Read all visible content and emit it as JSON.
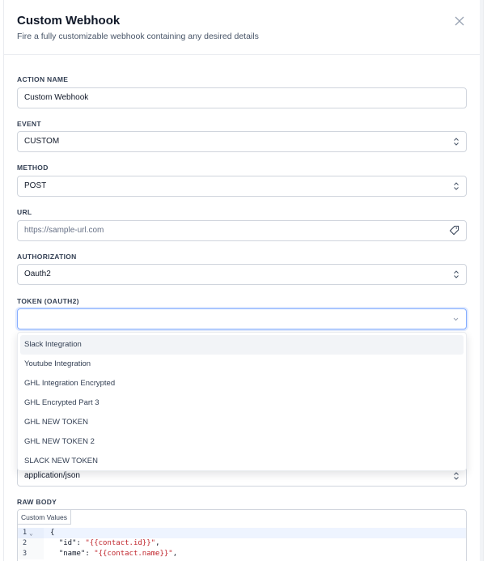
{
  "header": {
    "title": "Custom Webhook",
    "subtitle": "Fire a fully customizable webhook containing any desired details"
  },
  "form": {
    "action_name": {
      "label": "ACTION NAME",
      "value": "Custom Webhook"
    },
    "event": {
      "label": "EVENT",
      "value": "CUSTOM"
    },
    "method": {
      "label": "METHOD",
      "value": "POST"
    },
    "url": {
      "label": "URL",
      "placeholder": "https://sample-url.com"
    },
    "authorization": {
      "label": "AUTHORIZATION",
      "value": "Oauth2"
    },
    "token": {
      "label": "TOKEN (OAUTH2)",
      "value": ""
    },
    "content_type": {
      "value": "application/json"
    },
    "raw_body": {
      "label": "RAW BODY"
    }
  },
  "dropdown": {
    "options": [
      "Slack Integration",
      "Youtube Integration",
      "GHL Integration Encrypted",
      "GHL Encrypted Part 3",
      "GHL NEW TOKEN",
      "GHL NEW TOKEN 2",
      "SLACK NEW TOKEN"
    ],
    "highlighted_index": 0
  },
  "editor": {
    "custom_values_label": "Custom Values",
    "lines": [
      {
        "num": "1",
        "fold": "⌄",
        "key": "{",
        "val": "",
        "tail": ""
      },
      {
        "num": "2",
        "fold": "",
        "key": "  \"id\": ",
        "val": "\"{{contact.id}}\"",
        "tail": ","
      },
      {
        "num": "3",
        "fold": "",
        "key": "  \"name\": ",
        "val": "\"{{contact.name}}\"",
        "tail": ","
      }
    ]
  },
  "colors": {
    "accent_focus": "#84adff",
    "string": "#c0262d",
    "highlight": "#f2f4f7"
  },
  "icons": [
    "close-icon",
    "updown-chevron-icon",
    "chevron-down-icon",
    "tag-icon"
  ]
}
